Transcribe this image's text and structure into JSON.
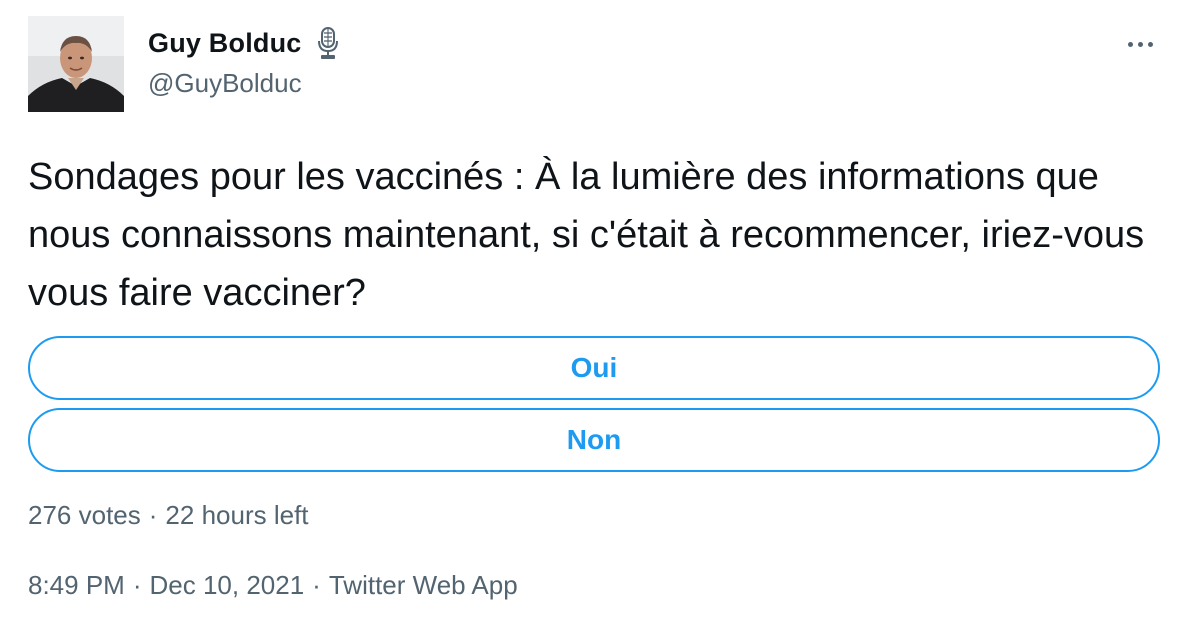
{
  "author": {
    "display_name": "Guy Bolduc",
    "handle": "@GuyBolduc",
    "badge_icon": "microphone-icon",
    "avatar_icon": "profile-photo-icon"
  },
  "menu": {
    "more_icon": "more-horizontal-icon"
  },
  "tweet": {
    "text": "Sondages pour les vaccinés : À la lumière des informations que nous connaissons maintenant, si c'était à recommencer, iriez-vous vous faire vacciner?"
  },
  "poll": {
    "options": [
      {
        "label": "Oui"
      },
      {
        "label": "Non"
      }
    ],
    "votes": "276 votes",
    "separator": "·",
    "time_left": "22 hours left"
  },
  "meta": {
    "time": "8:49 PM",
    "separator": "·",
    "date": "Dec 10, 2021",
    "source": "Twitter Web App"
  },
  "colors": {
    "accent": "#1d9bf0",
    "secondary_text": "#536471",
    "primary_text": "#0f1419"
  }
}
